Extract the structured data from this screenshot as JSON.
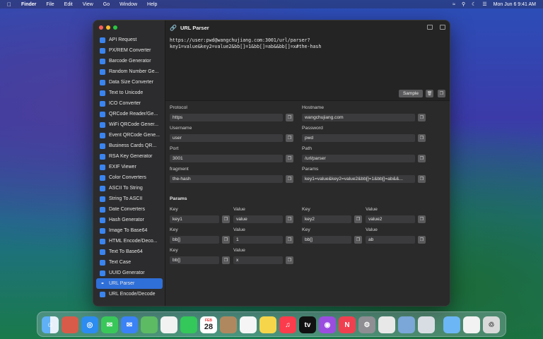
{
  "menubar": {
    "apple_icon": "apple-icon",
    "app_name": "Finder",
    "items": [
      "File",
      "Edit",
      "View",
      "Go",
      "Window",
      "Help"
    ],
    "clock": "Mon Jun 6  9:41 AM"
  },
  "window": {
    "title": "URL Parser",
    "sidebar": [
      {
        "label": "API Request",
        "color": "#3a84f0"
      },
      {
        "label": "PX/REM Converter",
        "color": "#3a84f0"
      },
      {
        "label": "Barcode Generator",
        "color": "#3a84f0"
      },
      {
        "label": "Random Number Ge...",
        "color": "#3a84f0"
      },
      {
        "label": "Data Size Converter",
        "color": "#3a84f0"
      },
      {
        "label": "Text to Unicode",
        "color": "#3a84f0"
      },
      {
        "label": "ICO Converter",
        "color": "#3a84f0"
      },
      {
        "label": "QRCode Reader/Ge...",
        "color": "#3a84f0"
      },
      {
        "label": "WiFi QRCode Gener...",
        "color": "#3a84f0"
      },
      {
        "label": "Event QRCode Gene...",
        "color": "#3a84f0"
      },
      {
        "label": "Business Cards QR...",
        "color": "#3a84f0"
      },
      {
        "label": "RSA Key Generator",
        "color": "#3a84f0"
      },
      {
        "label": "EXIF Viewer",
        "color": "#3a84f0"
      },
      {
        "label": "Color Converters",
        "color": "#3a84f0"
      },
      {
        "label": "ASCII To String",
        "color": "#3a84f0"
      },
      {
        "label": "String To ASCII",
        "color": "#3a84f0"
      },
      {
        "label": "Date Converters",
        "color": "#3a84f0"
      },
      {
        "label": "Hash Generator",
        "color": "#3a84f0"
      },
      {
        "label": "Image To Base64",
        "color": "#3a84f0"
      },
      {
        "label": "HTML Encode/Deco...",
        "color": "#3a84f0"
      },
      {
        "label": "Text To Base64",
        "color": "#3a84f0"
      },
      {
        "label": "Text Case",
        "color": "#3a84f0"
      },
      {
        "label": "UUID Generator",
        "color": "#3a84f0"
      },
      {
        "label": "URL Parser",
        "color": "#ffffff"
      },
      {
        "label": "URL Encode/Decode",
        "color": "#3a84f0"
      }
    ],
    "selected_index": 23,
    "input_text_line1": "https://user:pwd@wangchujiang.com:3001/url/parser?",
    "input_text_line2": "key1=value&key2=value2&bb[]=1&bb[]=ab&&bb[]=x#the-hash",
    "sample_label": "Sample",
    "fields": {
      "protocol": {
        "label": "Protocol",
        "value": "https"
      },
      "hostname": {
        "label": "Hostname",
        "value": "wangchujiang.com"
      },
      "username": {
        "label": "Username",
        "value": "user"
      },
      "password": {
        "label": "Password",
        "value": "pwd"
      },
      "port": {
        "label": "Port",
        "value": "3001"
      },
      "path": {
        "label": "Path",
        "value": "/url/parser"
      },
      "fragment": {
        "label": "fragment",
        "value": "the-hash"
      },
      "params": {
        "label": "Params",
        "value": "key1=value&key2=value2&bb[]=1&bb[]=ab&&..."
      }
    },
    "params_title": "Params",
    "key_label": "Key",
    "value_label": "Value",
    "params": [
      {
        "key": "key1",
        "value": "value"
      },
      {
        "key": "key2",
        "value": "value2"
      },
      {
        "key": "bb[]",
        "value": "1"
      },
      {
        "key": "bb[]",
        "value": "ab"
      },
      {
        "key": "bb[]",
        "value": "x"
      }
    ]
  },
  "dock": {
    "calendar_month": "FEB",
    "calendar_day": "28",
    "apps": [
      "finder",
      "launchpad",
      "safari",
      "messages",
      "mail",
      "maps",
      "photos",
      "facetime",
      "calendar",
      "contacts",
      "reminders",
      "notes",
      "music",
      "tv",
      "podcasts",
      "news",
      "settings",
      "script-editor",
      "preview",
      "app",
      "folder",
      "document",
      "trash"
    ]
  }
}
